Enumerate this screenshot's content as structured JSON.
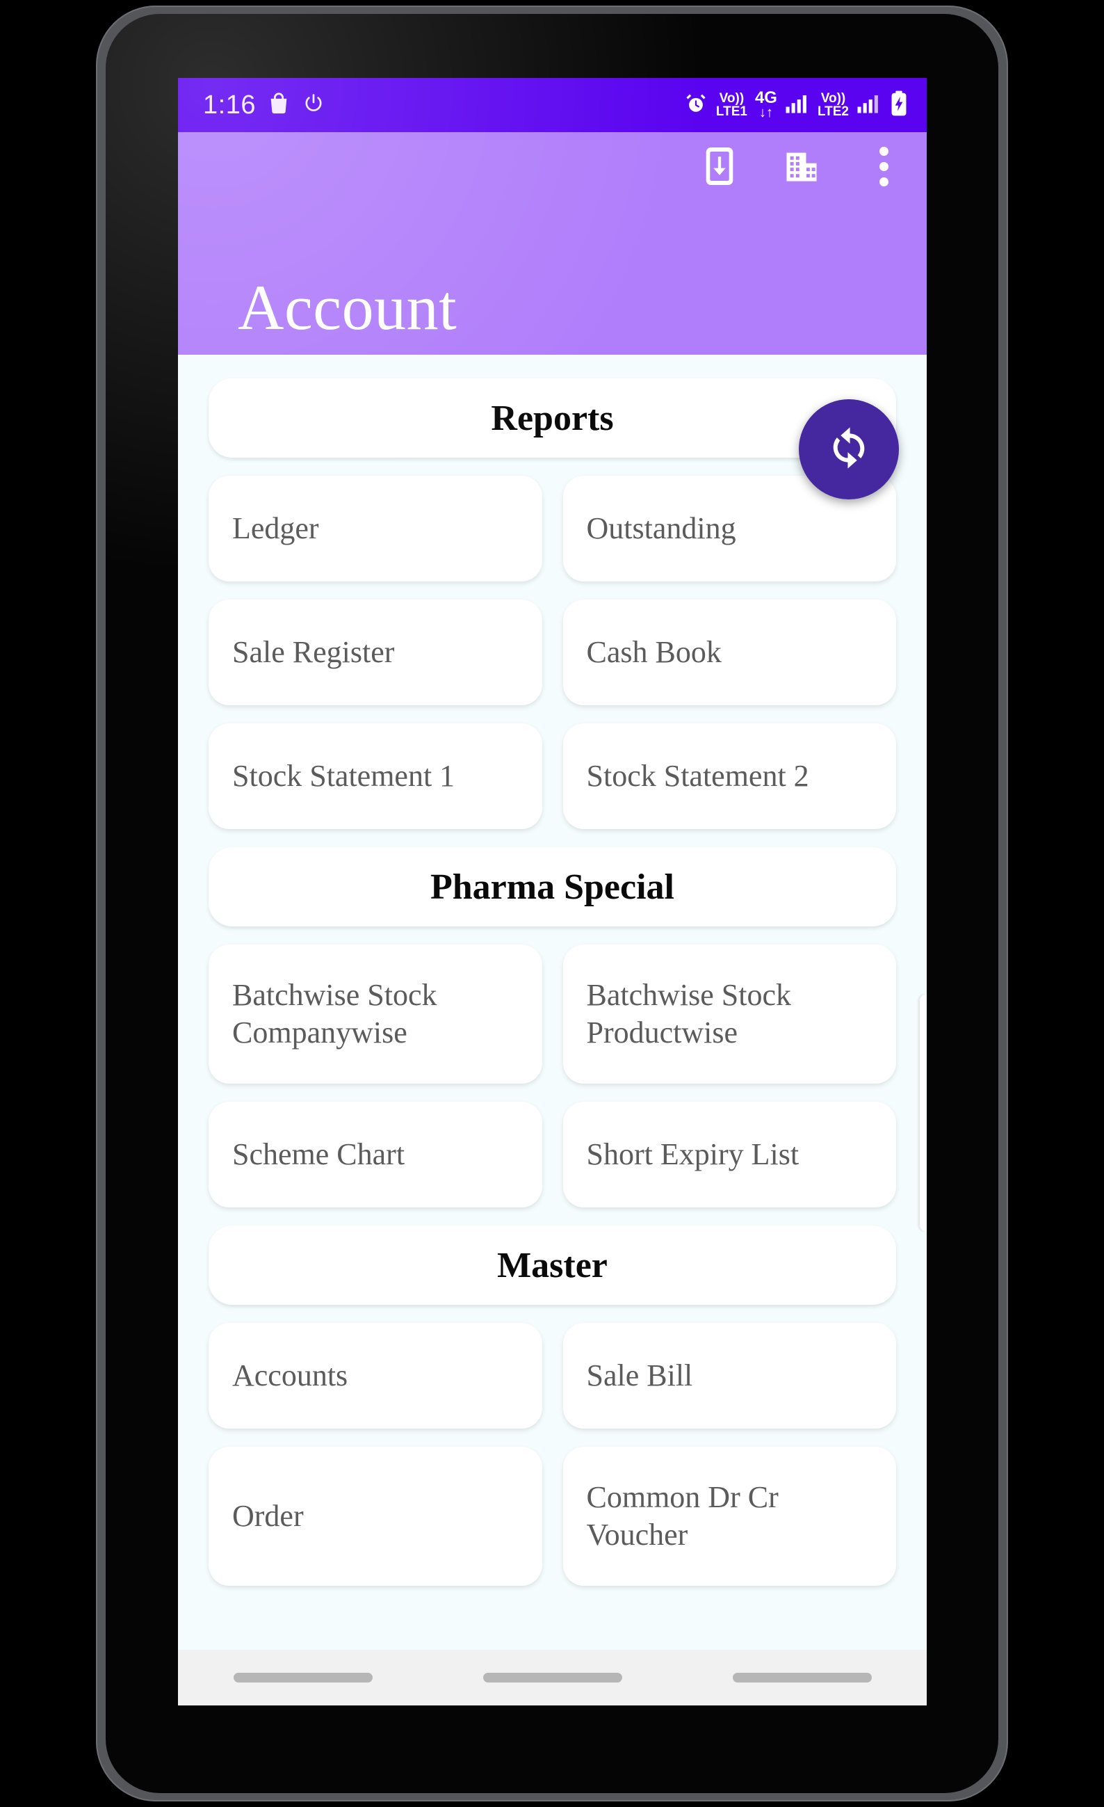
{
  "status_bar": {
    "time": "1:16",
    "left_icons": [
      "shopping-bag-icon",
      "power-icon"
    ],
    "right_icons": [
      "alarm-clock-icon",
      "volte1-icon",
      "4g-data-icon",
      "signal-bars-1-icon",
      "volte2-icon",
      "signal-bars-2-icon",
      "battery-charging-icon"
    ],
    "volte1_line1": "Vo))",
    "volte1_line2": "LTE1",
    "volte2_line1": "Vo))",
    "volte2_line2": "LTE2",
    "network_type": "4G",
    "background_color": "#5A03F0"
  },
  "app_bar": {
    "title": "Account",
    "background_color": "#B07DFB",
    "actions": [
      {
        "name": "download-to-phone-icon",
        "label": "Download"
      },
      {
        "name": "company-building-icon",
        "label": "Company"
      },
      {
        "name": "overflow-menu-icon",
        "label": "More options"
      }
    ]
  },
  "fab": {
    "name": "sync-refresh-icon",
    "label": "Sync",
    "background_color": "#4527A0"
  },
  "content": {
    "background_color": "#F4FCFD",
    "sections": [
      {
        "header": "Reports",
        "rows": [
          {
            "size": "h1",
            "tiles": [
              "Ledger",
              "Outstanding"
            ]
          },
          {
            "size": "h1",
            "tiles": [
              "Sale Register",
              "Cash Book"
            ]
          },
          {
            "size": "h1",
            "tiles": [
              "Stock Statement 1",
              "Stock Statement 2"
            ]
          }
        ]
      },
      {
        "header": "Pharma Special",
        "rows": [
          {
            "size": "h2",
            "tiles": [
              "Batchwise Stock Companywise",
              "Batchwise Stock Productwise"
            ]
          },
          {
            "size": "h1",
            "tiles": [
              "Scheme Chart",
              "Short Expiry List"
            ]
          }
        ]
      },
      {
        "header": "Master",
        "rows": [
          {
            "size": "h1",
            "tiles": [
              "Accounts",
              "Sale Bill"
            ]
          },
          {
            "size": "h2",
            "tiles": [
              "Order",
              "Common Dr Cr Voucher"
            ]
          }
        ]
      }
    ]
  },
  "nav_bar": {
    "background_color": "#F1F1F1",
    "buttons": [
      "recents-button",
      "home-button",
      "back-button"
    ]
  }
}
